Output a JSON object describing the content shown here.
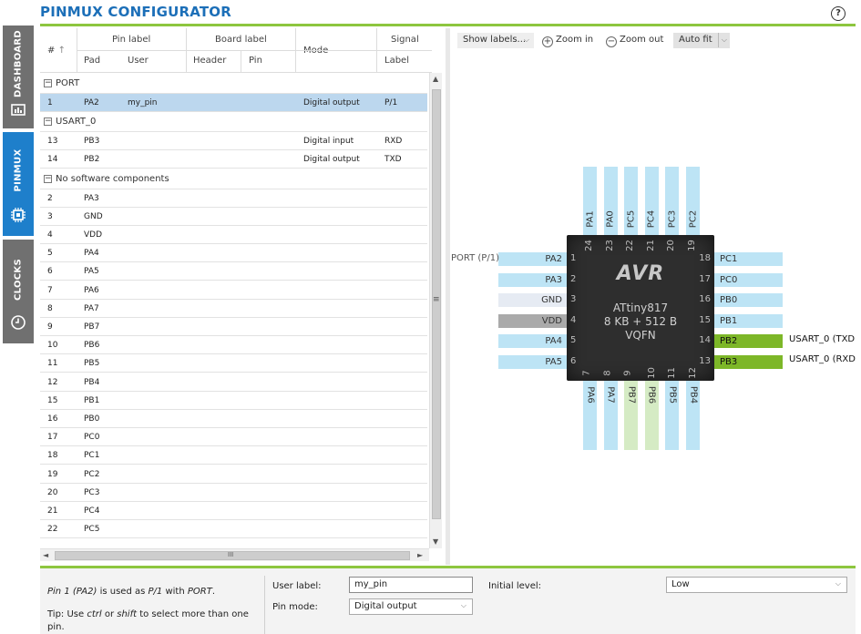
{
  "app": {
    "title": "PINMUX CONFIGURATOR",
    "help": "?"
  },
  "sidebar": {
    "tabs": [
      {
        "label": "DASHBOARD"
      },
      {
        "label": "PINMUX"
      },
      {
        "label": "CLOCKS"
      }
    ]
  },
  "table": {
    "headers": {
      "num": "#",
      "sort_arrow": "↑",
      "pin_label": "Pin label",
      "pad": "Pad",
      "user": "User",
      "board_label": "Board label",
      "header": "Header",
      "pin": "Pin",
      "mode": "Mode",
      "signal": "Signal",
      "label": "Label"
    },
    "groups": [
      {
        "name": "PORT",
        "rows": [
          {
            "num": "1",
            "pad": "PA2",
            "user": "my_pin",
            "mode": "Digital output",
            "label": "P/1",
            "selected": true
          }
        ]
      },
      {
        "name": "USART_0",
        "rows": [
          {
            "num": "13",
            "pad": "PB3",
            "user": "",
            "mode": "Digital input",
            "label": "RXD"
          },
          {
            "num": "14",
            "pad": "PB2",
            "user": "",
            "mode": "Digital output",
            "label": "TXD"
          }
        ]
      },
      {
        "name": "No software components",
        "rows": [
          {
            "num": "2",
            "pad": "PA3"
          },
          {
            "num": "3",
            "pad": "GND"
          },
          {
            "num": "4",
            "pad": "VDD"
          },
          {
            "num": "5",
            "pad": "PA4"
          },
          {
            "num": "6",
            "pad": "PA5"
          },
          {
            "num": "7",
            "pad": "PA6"
          },
          {
            "num": "8",
            "pad": "PA7"
          },
          {
            "num": "9",
            "pad": "PB7"
          },
          {
            "num": "10",
            "pad": "PB6"
          },
          {
            "num": "11",
            "pad": "PB5"
          },
          {
            "num": "12",
            "pad": "PB4"
          },
          {
            "num": "15",
            "pad": "PB1"
          },
          {
            "num": "16",
            "pad": "PB0"
          },
          {
            "num": "17",
            "pad": "PC0"
          },
          {
            "num": "18",
            "pad": "PC1"
          },
          {
            "num": "19",
            "pad": "PC2"
          },
          {
            "num": "20",
            "pad": "PC3"
          },
          {
            "num": "21",
            "pad": "PC4"
          },
          {
            "num": "22",
            "pad": "PC5"
          }
        ]
      }
    ],
    "scroll": {
      "up": "▲",
      "down": "▼",
      "left": "◄",
      "right": "►",
      "grip_v": "≡",
      "grip_h": "III"
    }
  },
  "toolbar": {
    "show_labels": "Show labels...",
    "zoom_in": "Zoom in",
    "zoom_out": "Zoom out",
    "auto_fit": "Auto fit",
    "plus": "+",
    "minus": "−",
    "chevron": "⌵"
  },
  "chip": {
    "logo": "AVR",
    "name": "ATtiny817",
    "memory": "8 KB + 512 B",
    "package": "VQFN",
    "left_pins": [
      {
        "num": "1",
        "name": "PA2",
        "color": "#bde4f5"
      },
      {
        "num": "2",
        "name": "PA3",
        "color": "#bde4f5"
      },
      {
        "num": "3",
        "name": "GND",
        "color": "#e6ebf3"
      },
      {
        "num": "4",
        "name": "VDD",
        "color": "#aaaaaa"
      },
      {
        "num": "5",
        "name": "PA4",
        "color": "#bde4f5"
      },
      {
        "num": "6",
        "name": "PA5",
        "color": "#bde4f5"
      }
    ],
    "right_pins": [
      {
        "num": "18",
        "name": "PC1",
        "color": "#bde4f5"
      },
      {
        "num": "17",
        "name": "PC0",
        "color": "#bde4f5"
      },
      {
        "num": "16",
        "name": "PB0",
        "color": "#bde4f5"
      },
      {
        "num": "15",
        "name": "PB1",
        "color": "#bde4f5"
      },
      {
        "num": "14",
        "name": "PB2",
        "color": "#7db728"
      },
      {
        "num": "13",
        "name": "PB3",
        "color": "#7db728"
      }
    ],
    "top_pins": [
      {
        "num": "24",
        "name": "PA1",
        "color": "#bde4f5"
      },
      {
        "num": "23",
        "name": "PA0",
        "color": "#bde4f5"
      },
      {
        "num": "22",
        "name": "PC5",
        "color": "#bde4f5"
      },
      {
        "num": "21",
        "name": "PC4",
        "color": "#bde4f5"
      },
      {
        "num": "20",
        "name": "PC3",
        "color": "#bde4f5"
      },
      {
        "num": "19",
        "name": "PC2",
        "color": "#bde4f5"
      }
    ],
    "bottom_pins": [
      {
        "num": "7",
        "name": "PA6",
        "color": "#bde4f5"
      },
      {
        "num": "8",
        "name": "PA7",
        "color": "#bde4f5"
      },
      {
        "num": "9",
        "name": "PB7",
        "color": "#d5ebc4"
      },
      {
        "num": "10",
        "name": "PB6",
        "color": "#d5ebc4"
      },
      {
        "num": "11",
        "name": "PB5",
        "color": "#bde4f5"
      },
      {
        "num": "12",
        "name": "PB4",
        "color": "#bde4f5"
      }
    ],
    "ext_left": "PORT (P/1)",
    "ext_right_txd": "USART_0 (TXD",
    "ext_right_rxd": "USART_0 (RXD"
  },
  "bottom": {
    "info_prefix": "Pin 1 (PA2)",
    "info_mid": " is used as ",
    "info_sig": "P/1",
    "info_with": " with ",
    "info_comp": "PORT",
    "info_end": ".",
    "tip_1": "Tip: Use ",
    "tip_ctrl": "ctrl",
    "tip_or": " or ",
    "tip_shift": "shift",
    "tip_2": " to select more than one",
    "tip_3": "pin.",
    "user_label_label": "User label:",
    "user_label_value": "my_pin",
    "pin_mode_label": "Pin mode:",
    "pin_mode_value": "Digital output",
    "initial_level_label": "Initial level:",
    "initial_level_value": "Low"
  }
}
